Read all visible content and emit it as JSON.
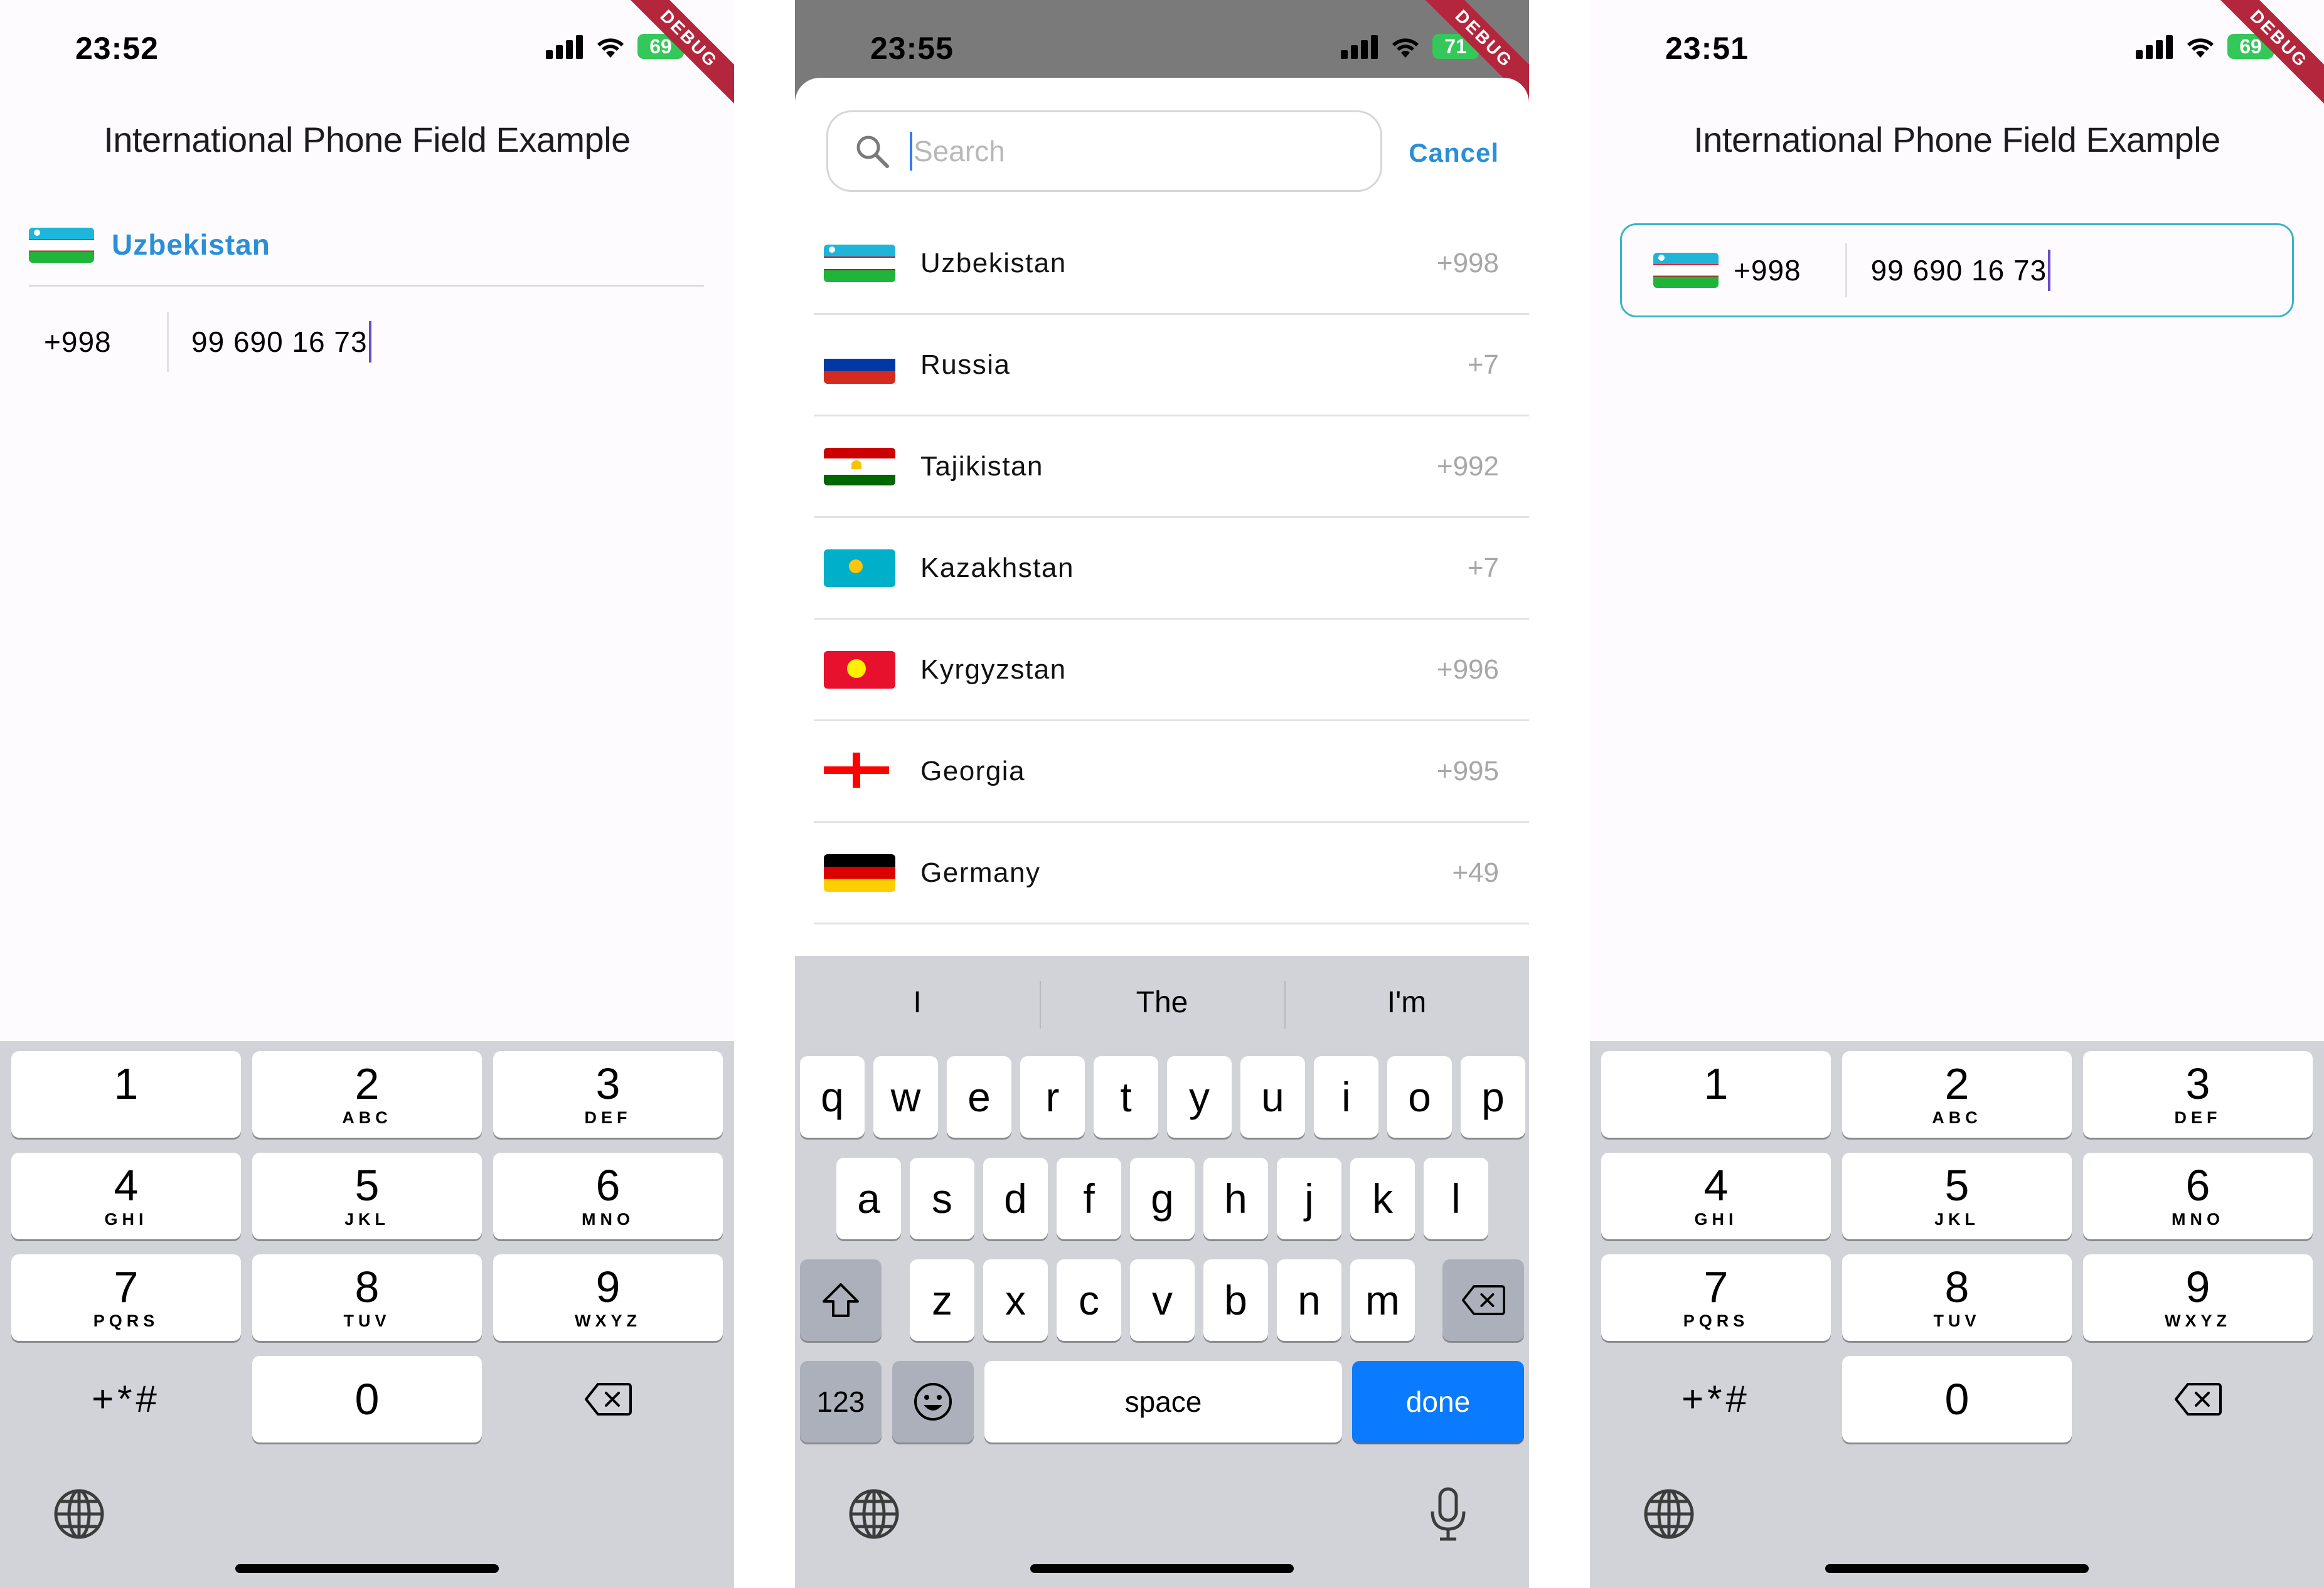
{
  "screens": [
    {
      "status": {
        "time": "23:52",
        "battery": "69"
      },
      "debug_label": "DEBUG",
      "title": "International Phone Field Example",
      "country": "Uzbekistan",
      "dial_code": "+998",
      "phone": "99 690 16 73"
    },
    {
      "status": {
        "time": "23:55",
        "battery": "71"
      },
      "debug_label": "DEBUG",
      "search": {
        "placeholder": "Search",
        "cancel": "Cancel"
      },
      "countries": [
        {
          "name": "Uzbekistan",
          "code": "+998",
          "flag": "uz"
        },
        {
          "name": "Russia",
          "code": "+7",
          "flag": "ru"
        },
        {
          "name": "Tajikistan",
          "code": "+992",
          "flag": "tj"
        },
        {
          "name": "Kazakhstan",
          "code": "+7",
          "flag": "kz"
        },
        {
          "name": "Kyrgyzstan",
          "code": "+996",
          "flag": "kg"
        },
        {
          "name": "Georgia",
          "code": "+995",
          "flag": "ge"
        },
        {
          "name": "Germany",
          "code": "+49",
          "flag": "de"
        }
      ],
      "keyboard": {
        "suggestions": [
          "I",
          "The",
          "I'm"
        ],
        "row1": [
          "q",
          "w",
          "e",
          "r",
          "t",
          "y",
          "u",
          "i",
          "o",
          "p"
        ],
        "row2": [
          "a",
          "s",
          "d",
          "f",
          "g",
          "h",
          "j",
          "k",
          "l"
        ],
        "row3": [
          "z",
          "x",
          "c",
          "v",
          "b",
          "n",
          "m"
        ],
        "numbers_label": "123",
        "space_label": "space",
        "done_label": "done"
      }
    },
    {
      "status": {
        "time": "23:51",
        "battery": "69"
      },
      "debug_label": "DEBUG",
      "title": "International Phone Field Example",
      "dial_code": "+998",
      "phone": "99 690 16 73"
    }
  ],
  "numpad": {
    "keys": [
      {
        "digit": "1",
        "letters": ""
      },
      {
        "digit": "2",
        "letters": "ABC"
      },
      {
        "digit": "3",
        "letters": "DEF"
      },
      {
        "digit": "4",
        "letters": "GHI"
      },
      {
        "digit": "5",
        "letters": "JKL"
      },
      {
        "digit": "6",
        "letters": "MNO"
      },
      {
        "digit": "7",
        "letters": "PQRS"
      },
      {
        "digit": "8",
        "letters": "TUV"
      },
      {
        "digit": "9",
        "letters": "WXYZ"
      }
    ],
    "symbols": "+*#",
    "zero": "0"
  },
  "colors": {
    "accent": "#2a8fd8",
    "field_border": "#3ab4c8",
    "keyboard_bg": "#d1d3d9",
    "done_key": "#0a7aff",
    "debug_ribbon": "#b3263b"
  }
}
